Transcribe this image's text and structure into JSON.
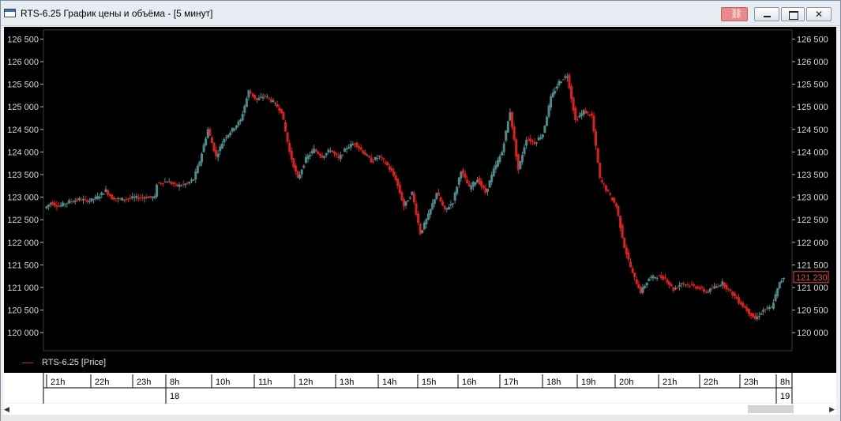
{
  "window": {
    "title": "RTS-6.25 График цены и объёма - [5 минут]"
  },
  "legend": {
    "label": "RTS-6.25 [Price]"
  },
  "colors": {
    "background": "#000000",
    "up": "#4f8a8a",
    "down": "#dd1f1f",
    "axis_text": "#d8d8d8",
    "price_badge": "#e74c3c"
  },
  "last_price": "121 230",
  "icons": [
    "app-icon",
    "link-icon",
    "minimize-icon",
    "maximize-icon",
    "close-icon"
  ],
  "time_axis": {
    "hours": [
      "21h",
      "22h",
      "23h",
      "8h",
      "10h",
      "11h",
      "12h",
      "13h",
      "14h",
      "15h",
      "16h",
      "17h",
      "18h",
      "19h",
      "20h",
      "21h",
      "22h",
      "23h",
      "8h"
    ],
    "dates": [
      "18",
      "19"
    ]
  },
  "chart_data": {
    "type": "candlestick",
    "title": "",
    "ylim": [
      119600,
      126700
    ],
    "yticks": [
      "126 500",
      "126 000",
      "125 500",
      "125 000",
      "124 500",
      "124 000",
      "123 500",
      "123 000",
      "122 500",
      "122 000",
      "121 500",
      "121 000",
      "120 500",
      "120 000"
    ],
    "grid": false,
    "series": [
      {
        "name": "RTS-6.25 [Price]",
        "path_points": [
          [
            0,
            122750
          ],
          [
            3,
            122880
          ],
          [
            7,
            122800
          ],
          [
            12,
            122900
          ],
          [
            17,
            122950
          ],
          [
            22,
            122920
          ],
          [
            26,
            123000
          ],
          [
            30,
            123150
          ],
          [
            33,
            122980
          ],
          [
            37,
            122950
          ],
          [
            42,
            122980
          ],
          [
            46,
            122990
          ],
          [
            50,
            123000
          ],
          [
            54,
            122990
          ],
          [
            55,
            123300
          ],
          [
            60,
            123350
          ],
          [
            65,
            123250
          ],
          [
            70,
            123300
          ],
          [
            73,
            123400
          ],
          [
            76,
            123800
          ],
          [
            80,
            124500
          ],
          [
            84,
            123900
          ],
          [
            88,
            124300
          ],
          [
            92,
            124500
          ],
          [
            96,
            124700
          ],
          [
            100,
            125350
          ],
          [
            104,
            125150
          ],
          [
            108,
            125250
          ],
          [
            112,
            125100
          ],
          [
            116,
            124900
          ],
          [
            120,
            124000
          ],
          [
            124,
            123400
          ],
          [
            128,
            123850
          ],
          [
            132,
            124050
          ],
          [
            136,
            123900
          ],
          [
            140,
            124050
          ],
          [
            144,
            123850
          ],
          [
            148,
            124100
          ],
          [
            152,
            124200
          ],
          [
            156,
            124000
          ],
          [
            160,
            123800
          ],
          [
            164,
            123900
          ],
          [
            168,
            123700
          ],
          [
            172,
            123400
          ],
          [
            176,
            122800
          ],
          [
            180,
            123100
          ],
          [
            184,
            122200
          ],
          [
            188,
            122600
          ],
          [
            192,
            123100
          ],
          [
            196,
            122700
          ],
          [
            200,
            122900
          ],
          [
            204,
            123600
          ],
          [
            208,
            123200
          ],
          [
            212,
            123400
          ],
          [
            216,
            123100
          ],
          [
            220,
            123600
          ],
          [
            224,
            124000
          ],
          [
            228,
            124900
          ],
          [
            232,
            123600
          ],
          [
            236,
            124300
          ],
          [
            240,
            124200
          ],
          [
            244,
            124400
          ],
          [
            248,
            125200
          ],
          [
            252,
            125550
          ],
          [
            256,
            125700
          ],
          [
            260,
            124700
          ],
          [
            264,
            124900
          ],
          [
            268,
            124800
          ],
          [
            272,
            123400
          ],
          [
            276,
            123100
          ],
          [
            280,
            122800
          ],
          [
            284,
            121900
          ],
          [
            288,
            121300
          ],
          [
            292,
            120900
          ],
          [
            296,
            121200
          ],
          [
            300,
            121250
          ],
          [
            304,
            121200
          ],
          [
            308,
            120950
          ],
          [
            312,
            121100
          ],
          [
            316,
            121050
          ],
          [
            320,
            121000
          ],
          [
            324,
            120900
          ],
          [
            328,
            121000
          ],
          [
            332,
            121100
          ],
          [
            336,
            120900
          ],
          [
            340,
            120700
          ],
          [
            344,
            120500
          ],
          [
            348,
            120300
          ],
          [
            352,
            120500
          ],
          [
            356,
            120550
          ],
          [
            360,
            121100
          ],
          [
            362,
            121230
          ]
        ]
      }
    ]
  }
}
